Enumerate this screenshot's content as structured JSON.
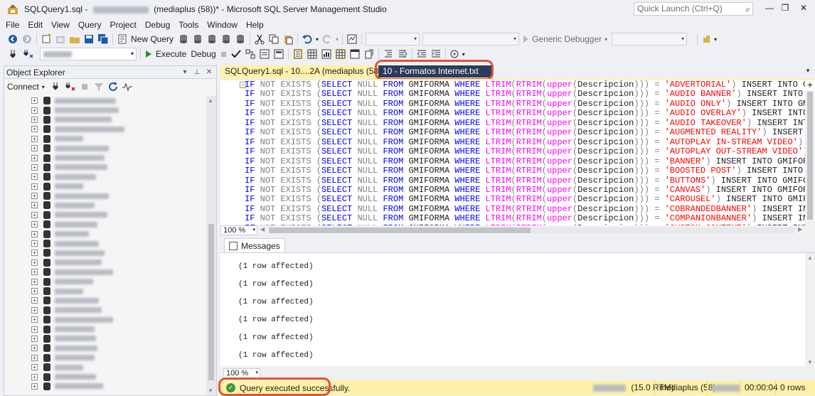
{
  "window": {
    "title_prefix": "SQLQuery1.sql -",
    "title_suffix": "(mediaplus (58))* - Microsoft SQL Server Management Studio",
    "quick_launch_placeholder": "Quick Launch (Ctrl+Q)",
    "minimize": "—",
    "restore": "❐",
    "close": "✕"
  },
  "menu": [
    "File",
    "Edit",
    "View",
    "Query",
    "Project",
    "Debug",
    "Tools",
    "Window",
    "Help"
  ],
  "toolbar": {
    "new_query": "New Query",
    "generic_debugger": "Generic Debugger",
    "execute": "Execute",
    "debug": "Debug"
  },
  "object_explorer": {
    "title": "Object Explorer",
    "connect": "Connect",
    "tree_rows": 31
  },
  "tabs": {
    "active": "SQLQuery1.sql - 10....2A (mediaplus (58))*",
    "inactive": "10 - Formatos Internet.txt"
  },
  "editor": {
    "lines": [
      [
        "ADVERTORIAL",
        "INSERT INTO GMIFORMA VALUES ((SELECT ISNU"
      ],
      [
        "AUDIO BANNER",
        "INSERT INTO GMIFORMA VALUES ((SELEC"
      ],
      [
        "AUDIO ONLY",
        "INSERT INTO GMIFORMA VALUES ((SELECT"
      ],
      [
        "AUDIO OVERLAY",
        "INSERT INTO GMIFORMA VALUES ((SELE"
      ],
      [
        "AUDIO TAKEOVER",
        "INSERT INTO GMIFORMA VALUES ((SEL"
      ],
      [
        "AUGMENTED REALITY",
        "INSERT INTO GMIFORMA VALUES (("
      ],
      [
        "AUTOPLAY IN-STREAM VIDEO",
        "INSERT INTO GMIFORMA VALUES"
      ],
      [
        "AUTOPLAY OUT-STREAM VIDEO",
        "INSERT INTO GMIFORMA VA"
      ],
      [
        "BANNER",
        "INSERT INTO GMIFORMA VALUES ((SELECT ISNU"
      ],
      [
        "BOOSTED POST",
        "INSERT INTO GMIFORMA VALUES ((SELEC"
      ],
      [
        "BUTTONS",
        "INSERT INTO GMIFORMA VALUES ((SELECT ISNU"
      ],
      [
        "CANVAS",
        "INSERT INTO GMIFORMA VALUES ((SELECT ISNU"
      ],
      [
        "CAROUSEL",
        "INSERT INTO GMIFORMA VALUES ((SELECT IS"
      ],
      [
        "COBRANDEDBANNER",
        "INSERT INTO GMIFORMA VALUES ((SE"
      ],
      [
        "COMPANIONBANNER",
        "INSERT INTO GMIFORMA VALUES ((SE"
      ],
      [
        "CUSTOM CONTENT",
        "INSERT INTO GMIFORMA VALUES ((SEL"
      ]
    ],
    "zoom": "100 %"
  },
  "results": {
    "tab": "Messages",
    "messages": [
      "(1 row affected)",
      "(1 row affected)",
      "(1 row affected)",
      "(1 row affected)",
      "(1 row affected)",
      "(1 row affected)"
    ],
    "zoom": "100 %"
  },
  "status": {
    "message": "Query executed successfully.",
    "version": "(15.0 RTM)",
    "user": "mediaplus (58)",
    "time": "00:00:04",
    "rows": "0 rows"
  },
  "colors": {
    "status_bar": "#fff1a8",
    "annotation": "#e05536",
    "keyword": "#0000ff",
    "function": "#ff00ff",
    "string": "#ff0000"
  }
}
